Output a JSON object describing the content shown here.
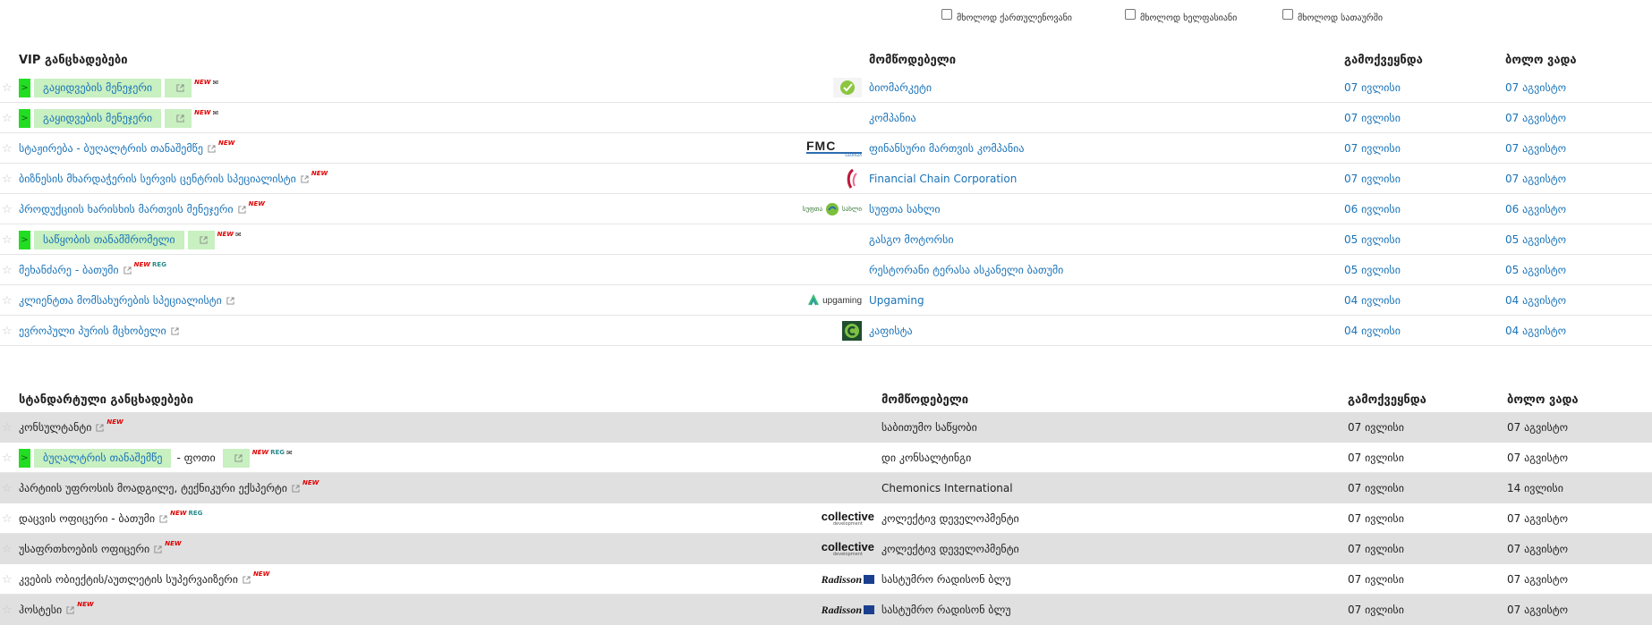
{
  "filters": [
    {
      "label": "მხოლოდ ქართულენოვანი",
      "checked": false
    },
    {
      "label": "მხოლოდ ხელფასიანი",
      "checked": false
    },
    {
      "label": "მხოლოდ სათაურში",
      "checked": false
    }
  ],
  "vip": {
    "headers": {
      "title": "VIP განცხადებები",
      "company": "მომწოდებელი",
      "published": "გამოქვეყნდა",
      "deadline": "ბოლო ვადა"
    },
    "rows": [
      {
        "title": "გაყიდვების მენეჯერი",
        "highlight": true,
        "new": "NEW",
        "extra": "✉",
        "company": "ბიომარკეტი",
        "logo": "biomarket",
        "published": "07 ივლისი",
        "deadline": "07 აგვისტო"
      },
      {
        "title": "გაყიდვების მენეჯერი",
        "highlight": true,
        "new": "NEW",
        "extra": "✉",
        "company": "კომპანია",
        "logo": "",
        "published": "07 ივლისი",
        "deadline": "07 აგვისტო"
      },
      {
        "title": "სტაჟირება - ბუღალტრის თანაშემწე",
        "highlight": false,
        "new": "NEW",
        "company": "ფინანსური მართვის კომპანია",
        "logo": "fmc",
        "published": "07 ივლისი",
        "deadline": "07 აგვისტო"
      },
      {
        "title": "ბიზნესის მხარდაჭერის სერვის ცენტრის სპეციალისტი",
        "highlight": false,
        "new": "NEW",
        "company": "Financial Chain Corporation",
        "logo": "fcc",
        "published": "07 ივლისი",
        "deadline": "07 აგვისტო"
      },
      {
        "title": "პროდუქციის ხარისხის მართვის მენეჯერი",
        "highlight": false,
        "new": "NEW",
        "company": "სუფთა სახლი",
        "logo": "sufta",
        "published": "06 ივლისი",
        "deadline": "06 აგვისტო"
      },
      {
        "title": "საწყობის თანამშრომელი",
        "highlight": true,
        "new": "NEW",
        "extra": "✉",
        "company": "გასგო მოტორსი",
        "logo": "",
        "published": "05 ივლისი",
        "deadline": "05 აგვისტო"
      },
      {
        "title": "მეხანძარე - ბათუმი",
        "highlight": false,
        "new": "NEW",
        "reg": "REG",
        "company": "რესტორანი ტერასა ასკანელი ბათუმი",
        "logo": "",
        "published": "05 ივლისი",
        "deadline": "05 აგვისტო"
      },
      {
        "title": "კლიენტთა მომსახურების სპეციალისტი",
        "highlight": false,
        "company": "Upgaming",
        "logo": "upgaming",
        "published": "04 ივლისი",
        "deadline": "04 აგვისტო"
      },
      {
        "title": "ევროპული პურის მცხობელი",
        "highlight": false,
        "company": "კაფისტა",
        "logo": "cafista",
        "published": "04 ივლისი",
        "deadline": "04 აგვისტო"
      }
    ]
  },
  "standard": {
    "headers": {
      "title": "სტანდარტული განცხადებები",
      "company": "მომწოდებელი",
      "published": "გამოქვეყნდა",
      "deadline": "ბოლო ვადა"
    },
    "rows": [
      {
        "title": "კონსულტანტი",
        "highlight": false,
        "new": "NEW",
        "company": "საბითუმო საწყობი",
        "logo": "",
        "published": "07 ივლისი",
        "deadline": "07 აგვისტო"
      },
      {
        "title": "ბუღალტრის თანაშემწე",
        "highlight": true,
        "sub": "- ფოთი",
        "new": "NEW",
        "reg": "REG",
        "extra": "✉",
        "company": "დი კონსალტინგი",
        "logo": "",
        "published": "07 ივლისი",
        "deadline": "07 აგვისტო"
      },
      {
        "title": "პარტიის უფროსის მოადგილე, ტექნიკური ექსპერტი",
        "highlight": false,
        "new": "NEW",
        "company": "Chemonics International",
        "logo": "",
        "published": "07 ივლისი",
        "deadline": "14 ივლისი"
      },
      {
        "title": "დაცვის ოფიცერი - ბათუმი",
        "highlight": false,
        "new": "NEW",
        "reg": "REG",
        "company": "კოლექტივ დეველოპმენტი",
        "logo": "collective",
        "published": "07 ივლისი",
        "deadline": "07 აგვისტო"
      },
      {
        "title": "უსაფრთხოების ოფიცერი",
        "highlight": false,
        "new": "NEW",
        "company": "კოლექტივ დეველოპმენტი",
        "logo": "collective",
        "published": "07 ივლისი",
        "deadline": "07 აგვისტო"
      },
      {
        "title": "კვების ობიექტის/აუთლეტის სუპერვაიზერი",
        "highlight": false,
        "new": "NEW",
        "company": "სასტუმრო რადისონ ბლუ",
        "logo": "radisson",
        "published": "07 ივლისი",
        "deadline": "07 აგვისტო"
      },
      {
        "title": "ჰოსტესი",
        "highlight": false,
        "new": "NEW",
        "company": "სასტუმრო რადისონ ბლუ",
        "logo": "radisson",
        "published": "07 ივლისი",
        "deadline": "07 აგვისტო"
      }
    ]
  },
  "logos": {
    "fmc_text": "FMC",
    "fmc_sub": "GEORGIA",
    "upgaming_text": "upgaming",
    "collective_text": "collective",
    "collective_sub": "development",
    "radisson_text": "Radisson",
    "sufta_text": "სუფთა სახლი"
  },
  "colors": {
    "link": "#1a73b8",
    "highlight_green": "#22dd22",
    "highlight_light": "#c8f0c0",
    "new_badge": "#e00000",
    "reg_badge": "#2a8a8a",
    "stripe": "#e0e0e0"
  }
}
